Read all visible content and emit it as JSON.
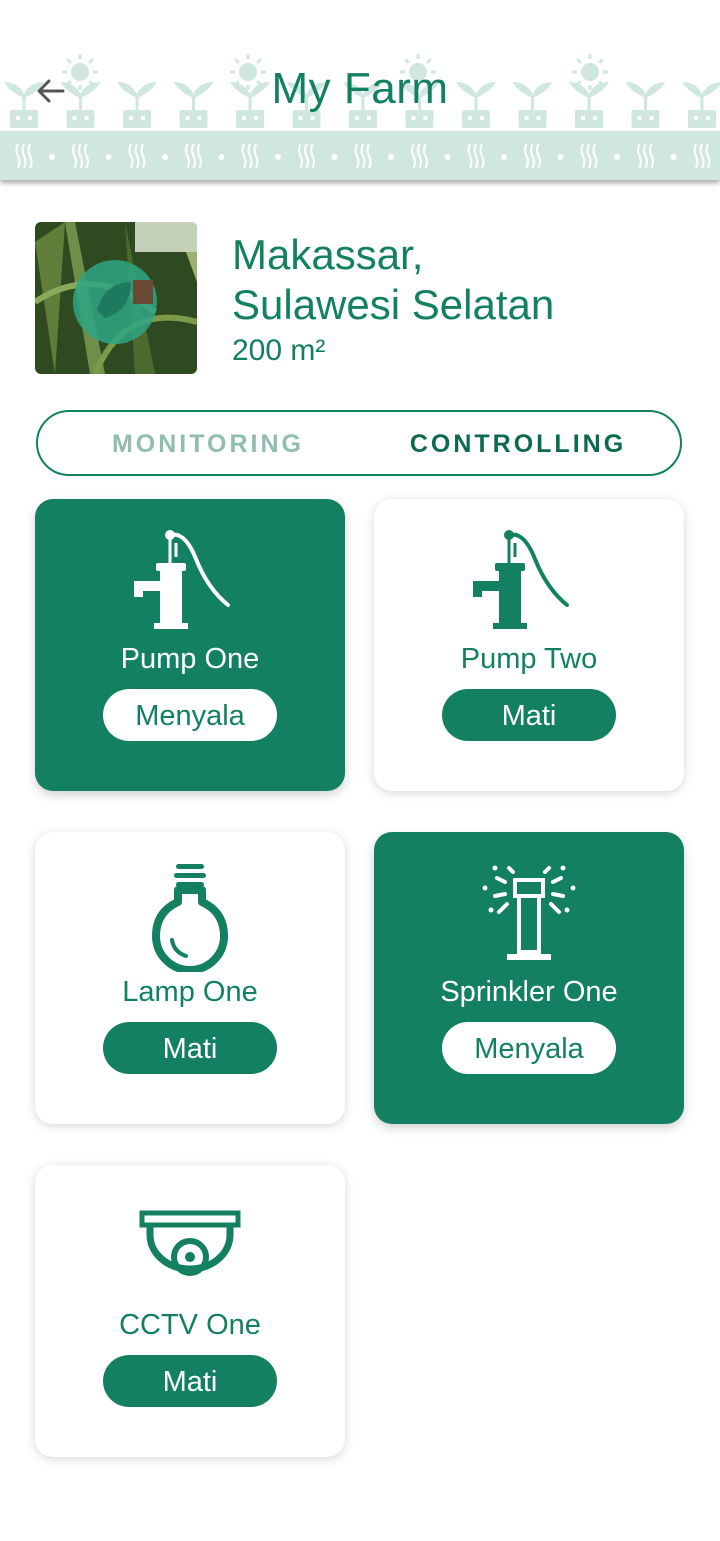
{
  "header": {
    "title": "My Farm"
  },
  "farm": {
    "location": "Makassar,\nSulawesi Selatan",
    "area": "200 m²"
  },
  "tabs": [
    {
      "label": "MONITORING",
      "active": false
    },
    {
      "label": "CONTROLLING",
      "active": true
    }
  ],
  "devices": [
    {
      "label": "Pump One",
      "status": "Menyala",
      "on": true,
      "icon": "water-pump-icon"
    },
    {
      "label": "Pump Two",
      "status": "Mati",
      "on": false,
      "icon": "water-pump-icon"
    },
    {
      "label": "Lamp One",
      "status": "Mati",
      "on": false,
      "icon": "lightbulb-icon"
    },
    {
      "label": "Sprinkler One",
      "status": "Menyala",
      "on": true,
      "icon": "sprinkler-icon"
    },
    {
      "label": "CCTV One",
      "status": "Mati",
      "on": false,
      "icon": "cctv-camera-icon"
    }
  ],
  "colors": {
    "primary": "#138062",
    "pattern": "#cfe7e0",
    "tab_inactive": "#8fbeb0"
  }
}
